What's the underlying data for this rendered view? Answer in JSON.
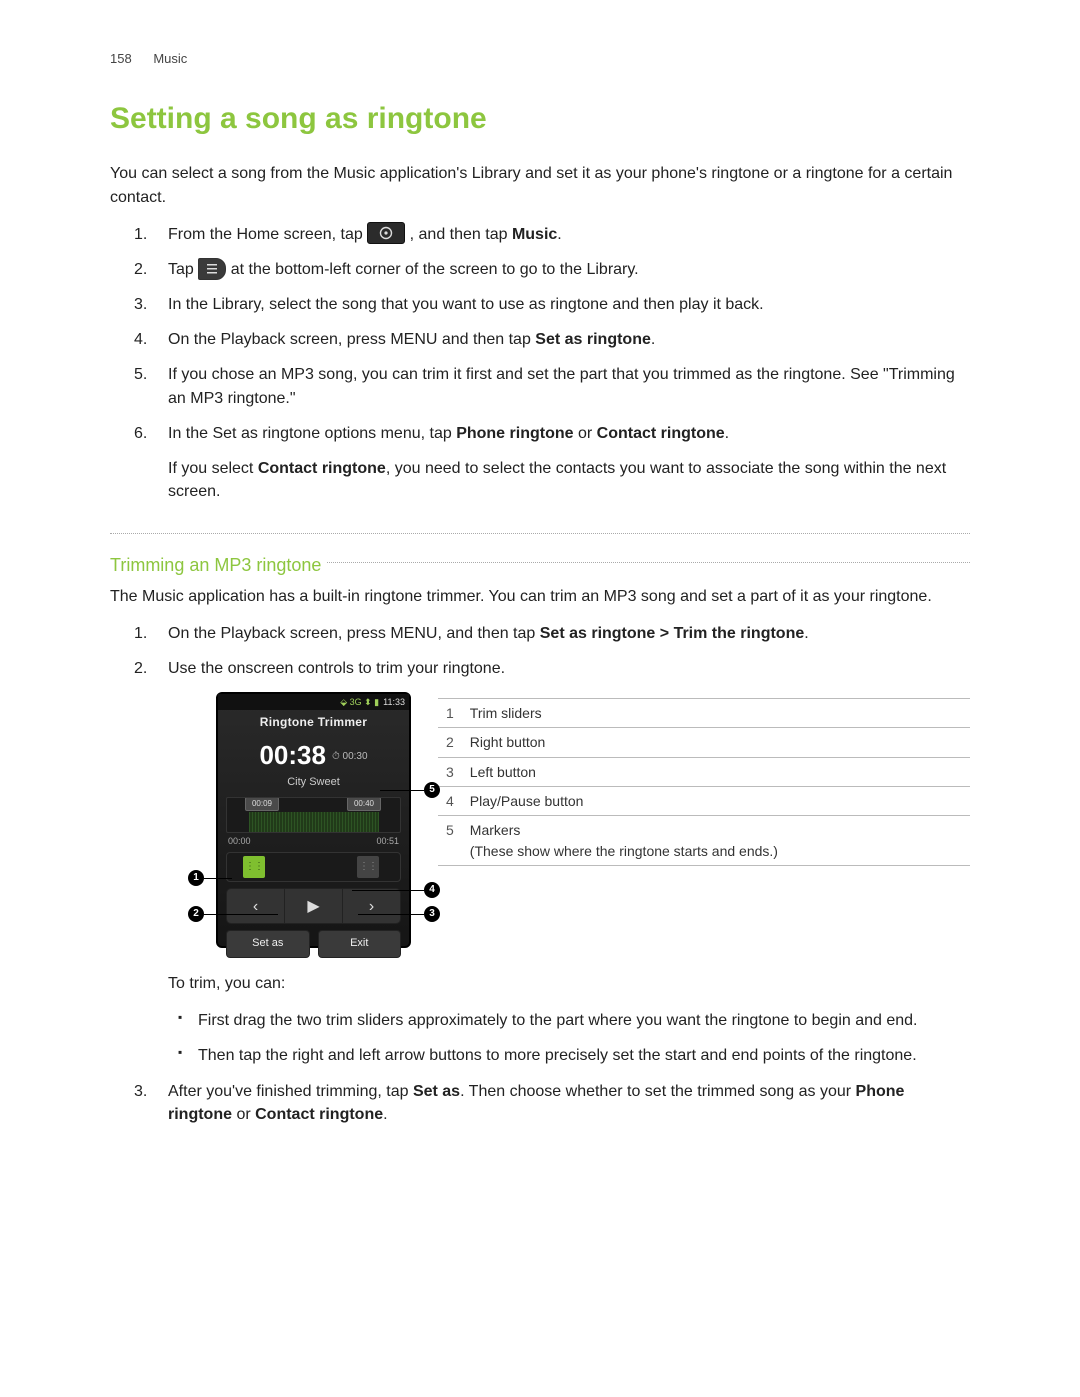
{
  "header": {
    "page": "158",
    "section": "Music"
  },
  "h1": "Setting a song as ringtone",
  "intro": "You can select a song from the Music application's Library and set it as your phone's ringtone or a ringtone for a certain contact.",
  "steps1": {
    "s1a": "From the Home screen, tap ",
    "s1b": ", and then tap ",
    "s1c": "Music",
    "s1d": ".",
    "s2a": "Tap ",
    "s2b": " at the bottom-left corner of the screen to go to the Library.",
    "s3": "In the Library, select the song that you want to use as ringtone and then play it back.",
    "s4a": "On the Playback screen, press MENU and then tap ",
    "s4b": "Set as ringtone",
    "s4c": ".",
    "s5": "If you chose an MP3 song, you can trim it first and set the part that you trimmed as the ringtone. See \"Trimming an MP3 ringtone.\"",
    "s6a": "In the Set as ringtone options menu, tap ",
    "s6b": "Phone ringtone",
    "s6c": " or ",
    "s6d": "Contact ringtone",
    "s6e": ".",
    "s6note_a": "If you select ",
    "s6note_b": "Contact ringtone",
    "s6note_c": ", you need to select the contacts you want to associate the song within the next screen."
  },
  "h2": "Trimming an MP3 ringtone",
  "intro2": "The Music application has a built-in ringtone trimmer. You can trim an MP3 song and set a part of it as your ringtone.",
  "steps2": {
    "s1a": "On the Playback screen, press MENU, and then tap ",
    "s1b": "Set as ringtone > Trim the ringtone",
    "s1c": ".",
    "s2": "Use the onscreen controls to trim your ringtone."
  },
  "phone": {
    "clock": "11:33",
    "title": "Ringtone Trimmer",
    "time": "00:38",
    "duration": "00:30",
    "track": "City Sweet",
    "slider1": "00:09",
    "slider2": "00:40",
    "t0": "00:00",
    "t1": "00:51",
    "btn_setas": "Set as",
    "btn_exit": "Exit"
  },
  "callouts": {
    "c1": "1",
    "c2": "2",
    "c3": "3",
    "c4": "4",
    "c5": "5"
  },
  "legend": {
    "r1n": "1",
    "r1": "Trim sliders",
    "r2n": "2",
    "r2": "Right button",
    "r3n": "3",
    "r3": "Left button",
    "r4n": "4",
    "r4": "Play/Pause button",
    "r5n": "5",
    "r5a": "Markers",
    "r5b": "(These show where the ringtone starts and ends.)"
  },
  "totrim": "To trim, you can:",
  "bullets": {
    "b1": "First drag the two trim sliders approximately to the part where you want the ringtone to begin and end.",
    "b2": "Then tap the right and left arrow buttons to more precisely set the start and end points of the ringtone."
  },
  "step3": {
    "a": "After you've finished trimming, tap ",
    "b": "Set as",
    "c": ". Then choose whether to set the trimmed song as your ",
    "d": "Phone ringtone",
    "e": " or ",
    "f": "Contact ringtone",
    "g": "."
  }
}
